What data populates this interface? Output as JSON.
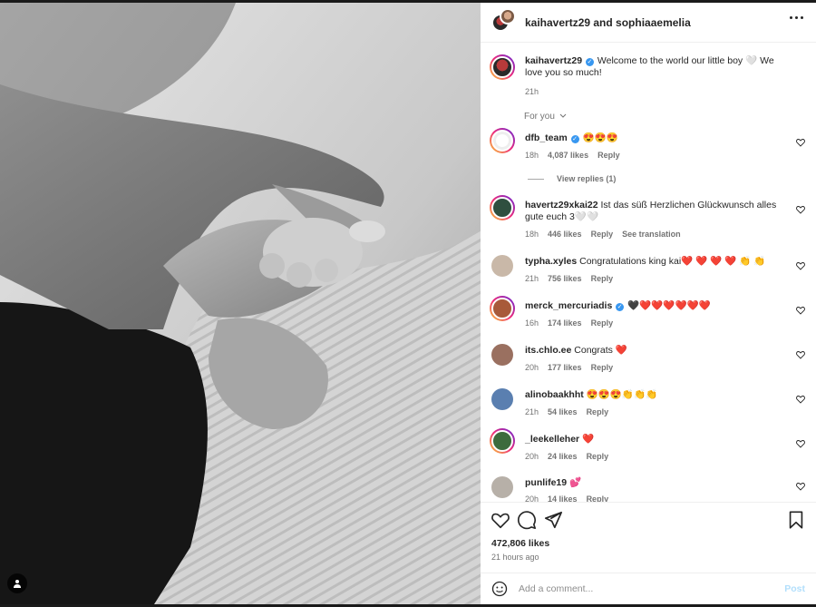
{
  "post": {
    "header_users": "kaihavertz29 and sophiaaemelia",
    "author": "kaihavertz29",
    "caption": "Welcome to the world our little boy 🤍 We love you so much!",
    "caption_time": "21h",
    "sort_label": "For you",
    "likes": "472,806 likes",
    "posted": "21 hours ago"
  },
  "comments": [
    {
      "user": "dfb_team",
      "verified": true,
      "text": "😍😍😍",
      "time": "18h",
      "likes": "4,087 likes",
      "reply": "Reply",
      "avatar_color": "#ffffff",
      "ring": true
    },
    {
      "user": "havertz29xkai22",
      "verified": false,
      "text": "Ist das süß Herzlichen Glückwunsch alles gute euch 3🤍🤍",
      "time": "18h",
      "likes": "446 likes",
      "reply": "Reply",
      "translate": "See translation",
      "avatar_color": "#2f4f3f",
      "ring": true
    },
    {
      "user": "typha.xyles",
      "verified": false,
      "text": "Congratulations king kai❤️ ❤️ ❤️ ❤️ 👏 👏",
      "time": "21h",
      "likes": "756 likes",
      "reply": "Reply",
      "avatar_color": "#c9b8a8",
      "ring": false
    },
    {
      "user": "merck_mercuriadis",
      "verified": true,
      "text": "🖤❤️❤️❤️❤️❤️❤️",
      "time": "16h",
      "likes": "174 likes",
      "reply": "Reply",
      "avatar_color": "#a85a3a",
      "ring": true
    },
    {
      "user": "its.chlo.ee",
      "verified": false,
      "text": "Congrats ❤️",
      "time": "20h",
      "likes": "177 likes",
      "reply": "Reply",
      "avatar_color": "#9a7060",
      "ring": false
    },
    {
      "user": "alinobaakhht",
      "verified": false,
      "text": "😍😍😍👏👏👏",
      "time": "21h",
      "likes": "54 likes",
      "reply": "Reply",
      "avatar_color": "#5a7fb0",
      "ring": false
    },
    {
      "user": "_leekelleher",
      "verified": false,
      "text": "❤️",
      "time": "20h",
      "likes": "24 likes",
      "reply": "Reply",
      "avatar_color": "#3d6b3d",
      "ring": true
    },
    {
      "user": "punlife19",
      "verified": false,
      "text": "💕",
      "time": "20h",
      "likes": "14 likes",
      "reply": "Reply",
      "avatar_color": "#b7b0a8",
      "ring": false
    }
  ],
  "view_replies": "View replies (1)",
  "composer": {
    "placeholder": "Add a comment...",
    "post_label": "Post"
  },
  "icons": {
    "like": "heart-icon",
    "comment": "comment-icon",
    "share": "share-icon",
    "save": "bookmark-icon",
    "emoji": "emoji-icon",
    "tags": "user-tag-icon",
    "more": "more-options-icon"
  }
}
